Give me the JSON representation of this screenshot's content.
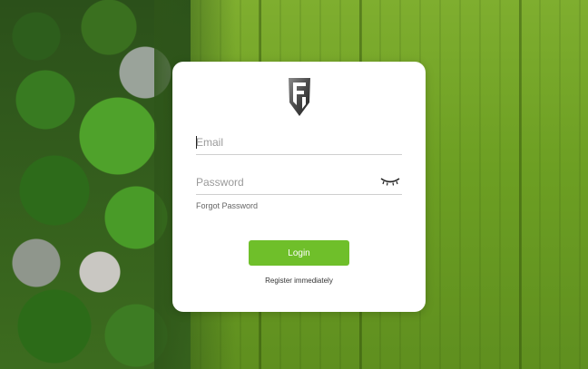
{
  "login_form": {
    "email_placeholder": "Email",
    "email_value": "",
    "password_placeholder": "Password",
    "password_value": "",
    "forgot_password_label": "Forgot Password",
    "login_button_label": "Login",
    "register_label": "Register immediately"
  },
  "icons": {
    "logo": "brand-shield-logo-icon",
    "password_visibility": "eye-closed-icon"
  },
  "colors": {
    "primary_button": "#6fbf2a",
    "card_background": "#ffffff",
    "input_underline": "#cfcfcf"
  }
}
